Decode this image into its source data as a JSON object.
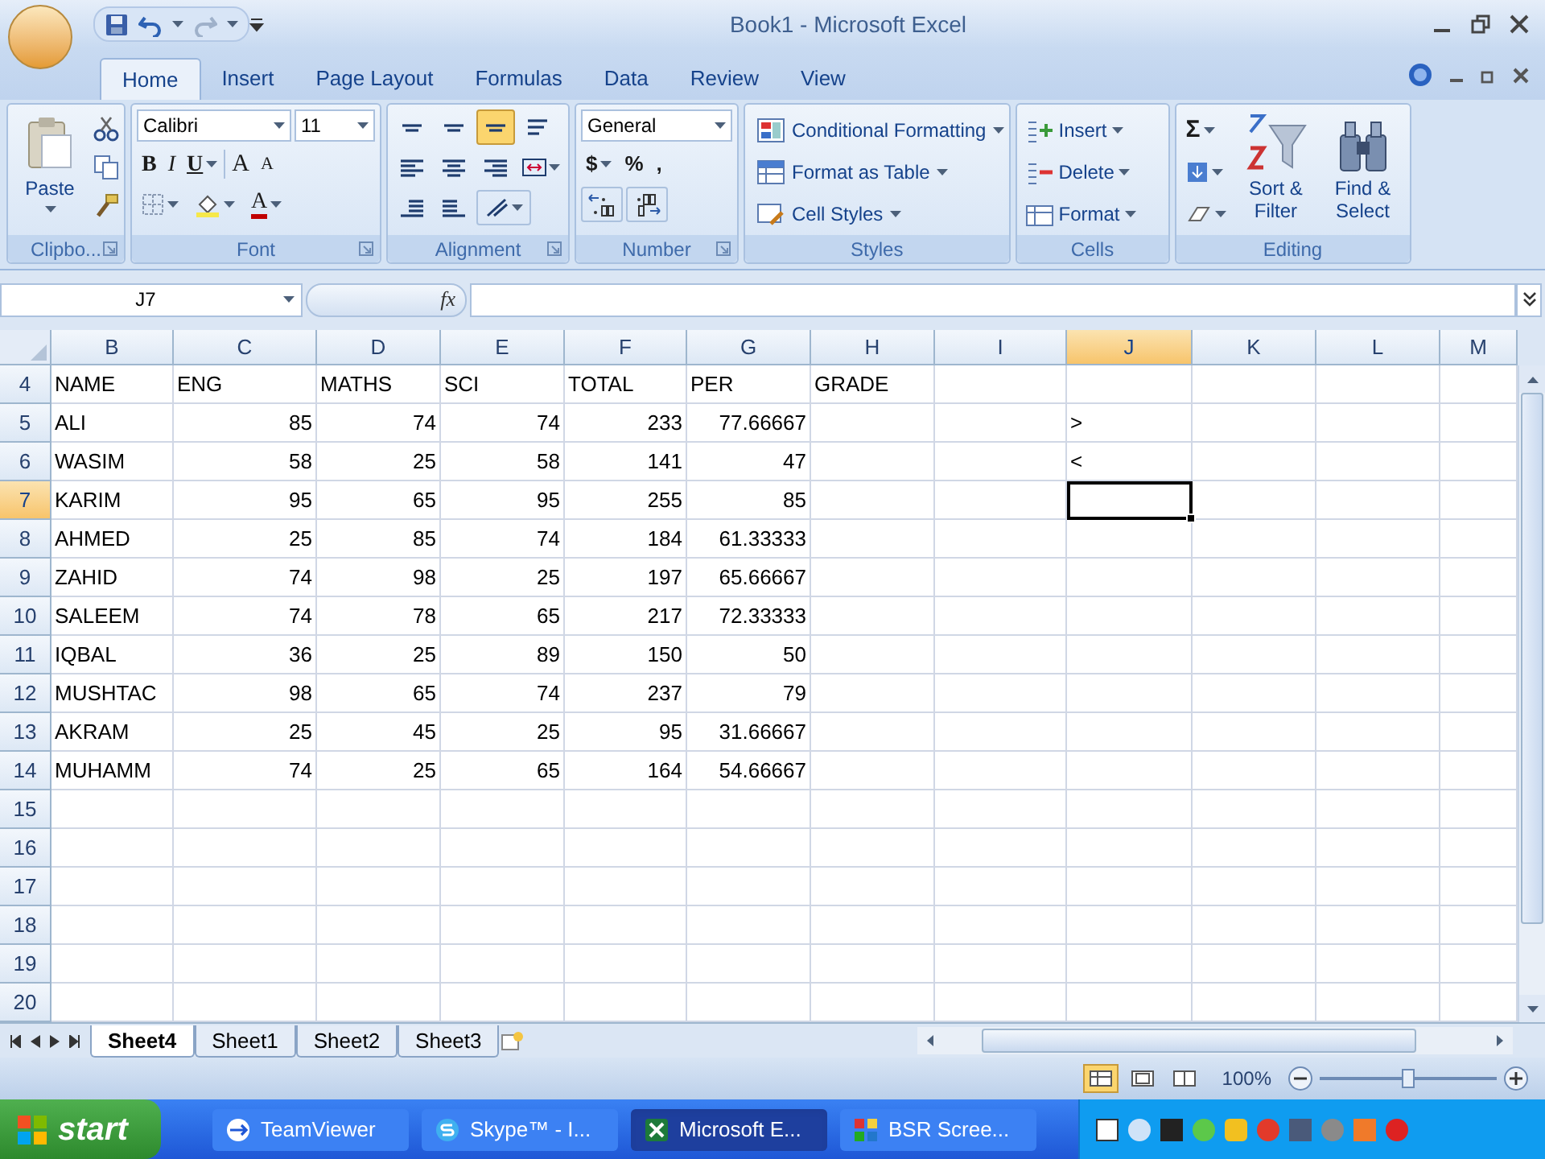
{
  "window": {
    "title": "Book1 - Microsoft Excel"
  },
  "ribbon_tabs": [
    {
      "label": "Home",
      "selected": true
    },
    {
      "label": "Insert",
      "selected": false
    },
    {
      "label": "Page Layout",
      "selected": false
    },
    {
      "label": "Formulas",
      "selected": false
    },
    {
      "label": "Data",
      "selected": false
    },
    {
      "label": "Review",
      "selected": false
    },
    {
      "label": "View",
      "selected": false
    }
  ],
  "clipboard": {
    "paste": "Paste",
    "group": "Clipbo..."
  },
  "font": {
    "name": "Calibri",
    "size": "11",
    "bold": "B",
    "italic": "I",
    "underline": "U",
    "grow": "A",
    "shrink": "A",
    "font_color_letter": "A",
    "group": "Font"
  },
  "alignment": {
    "group": "Alignment",
    "bottom_align_selected": true
  },
  "number": {
    "format": "General",
    "currency": "$",
    "percent": "%",
    "comma": ",",
    "group": "Number"
  },
  "styles": {
    "items": [
      "Conditional Formatting",
      "Format as Table",
      "Cell Styles"
    ],
    "group": "Styles"
  },
  "cells": {
    "items": [
      "Insert",
      "Delete",
      "Format"
    ],
    "group": "Cells"
  },
  "editing": {
    "sum": "Σ",
    "sort": "Sort & Filter",
    "find": "Find & Select",
    "group": "Editing"
  },
  "formula_bar": {
    "name_box": "J7",
    "function_label": "fx"
  },
  "sheet": {
    "columns": [
      {
        "label": "B",
        "selected": false
      },
      {
        "label": "C",
        "selected": false
      },
      {
        "label": "D",
        "selected": false
      },
      {
        "label": "E",
        "selected": false
      },
      {
        "label": "F",
        "selected": false
      },
      {
        "label": "G",
        "selected": false
      },
      {
        "label": "H",
        "selected": false
      },
      {
        "label": "I",
        "selected": false
      },
      {
        "label": "J",
        "selected": true
      },
      {
        "label": "K",
        "selected": false
      },
      {
        "label": "L",
        "selected": false
      },
      {
        "label": "M",
        "selected": false
      }
    ],
    "rows": [
      {
        "number": "4",
        "selected": false,
        "cells": {
          "B": "NAME",
          "C": "ENG",
          "D": "MATHS",
          "E": "SCI",
          "F": "TOTAL",
          "G": "PER",
          "H": "GRADE"
        }
      },
      {
        "number": "5",
        "selected": false,
        "cells": {
          "B": "ALI",
          "C": "85",
          "D": "74",
          "E": "74",
          "F": "233",
          "G": "77.66667",
          "J": ">"
        }
      },
      {
        "number": "6",
        "selected": false,
        "cells": {
          "B": "WASIM",
          "C": "58",
          "D": "25",
          "E": "58",
          "F": "141",
          "G": "47",
          "J": "<"
        }
      },
      {
        "number": "7",
        "selected": true,
        "cells": {
          "B": "KARIM",
          "C": "95",
          "D": "65",
          "E": "95",
          "F": "255",
          "G": "85"
        }
      },
      {
        "number": "8",
        "selected": false,
        "cells": {
          "B": "AHMED",
          "C": "25",
          "D": "85",
          "E": "74",
          "F": "184",
          "G": "61.33333"
        }
      },
      {
        "number": "9",
        "selected": false,
        "cells": {
          "B": "ZAHID",
          "C": "74",
          "D": "98",
          "E": "25",
          "F": "197",
          "G": "65.66667"
        }
      },
      {
        "number": "10",
        "selected": false,
        "cells": {
          "B": "SALEEM",
          "C": "74",
          "D": "78",
          "E": "65",
          "F": "217",
          "G": "72.33333"
        }
      },
      {
        "number": "11",
        "selected": false,
        "cells": {
          "B": "IQBAL",
          "C": "36",
          "D": "25",
          "E": "89",
          "F": "150",
          "G": "50"
        }
      },
      {
        "number": "12",
        "selected": false,
        "cells": {
          "B": "MUSHTAC",
          "C": "98",
          "D": "65",
          "E": "74",
          "F": "237",
          "G": "79"
        }
      },
      {
        "number": "13",
        "selected": false,
        "cells": {
          "B": "AKRAM",
          "C": "25",
          "D": "45",
          "E": "25",
          "F": "95",
          "G": "31.66667"
        }
      },
      {
        "number": "14",
        "selected": false,
        "cells": {
          "B": "MUHAMM",
          "C": "74",
          "D": "25",
          "E": "65",
          "F": "164",
          "G": "54.66667"
        }
      },
      {
        "number": "15",
        "selected": false,
        "cells": {}
      },
      {
        "number": "16",
        "selected": false,
        "cells": {}
      },
      {
        "number": "17",
        "selected": false,
        "cells": {}
      },
      {
        "number": "18",
        "selected": false,
        "cells": {}
      },
      {
        "number": "19",
        "selected": false,
        "cells": {}
      },
      {
        "number": "20",
        "selected": false,
        "cells": {}
      }
    ]
  },
  "sheet_tabs": [
    {
      "label": "Sheet4",
      "selected": true
    },
    {
      "label": "Sheet1",
      "selected": false
    },
    {
      "label": "Sheet2",
      "selected": false
    },
    {
      "label": "Sheet3",
      "selected": false
    }
  ],
  "status_bar": {
    "zoom": "100%",
    "zoom_slider": {
      "level": 0.5
    }
  },
  "taskbar": {
    "start": "start",
    "items": [
      {
        "label": "TeamViewer",
        "selected": false
      },
      {
        "label": "Skype™ - I...",
        "selected": false
      },
      {
        "label": "Microsoft E...",
        "selected": true
      },
      {
        "label": "BSR Scree...",
        "selected": false
      }
    ]
  }
}
